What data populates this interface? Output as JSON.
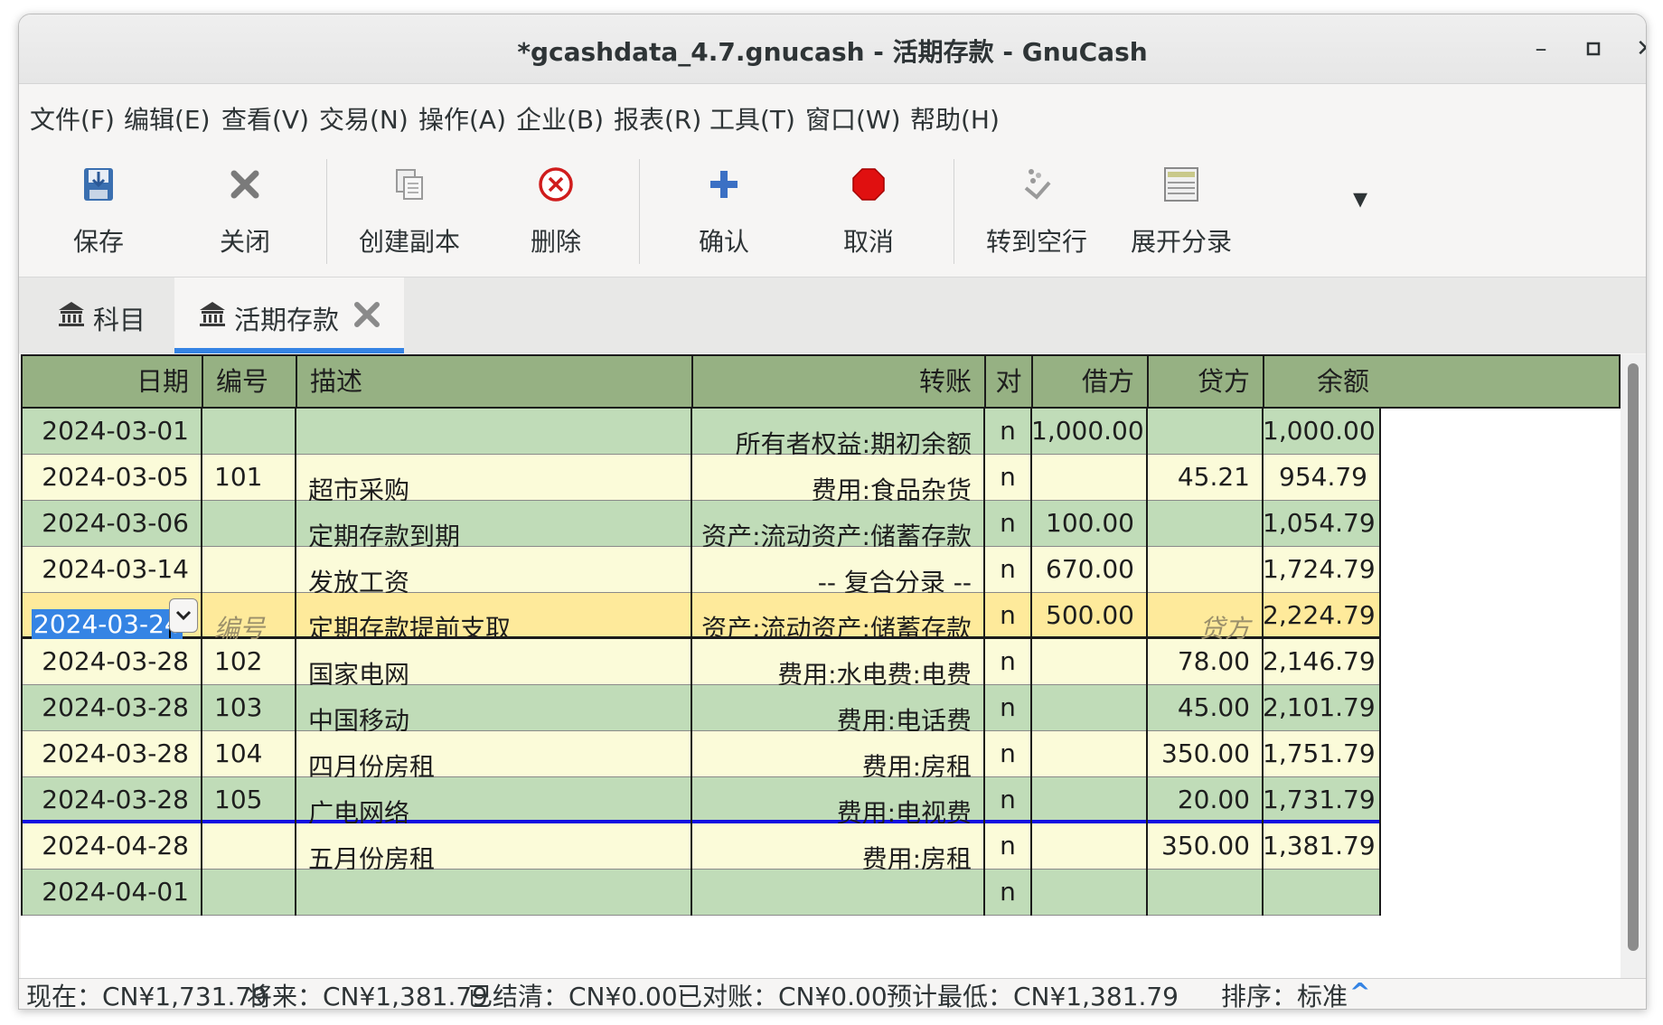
{
  "window": {
    "title": "*gcashdata_4.7.gnucash - 活期存款 - GnuCash",
    "minimize": "–",
    "maximize": "▫",
    "close": "✕"
  },
  "menu": [
    "文件(F)",
    "编辑(E)",
    "查看(V)",
    "交易(N)",
    "操作(A)",
    "企业(B)",
    "报表(R)",
    "工具(T)",
    "窗口(W)",
    "帮助(H)"
  ],
  "toolbar": {
    "save": "保存",
    "close": "关闭",
    "duplicate": "创建副本",
    "delete": "删除",
    "enter": "确认",
    "cancel": "取消",
    "blank": "转到空行",
    "split": "展开分录",
    "overflow": "▾"
  },
  "tabs": [
    {
      "label": "科目"
    },
    {
      "label": "活期存款"
    }
  ],
  "register": {
    "headers": {
      "date": "日期",
      "num": "编号",
      "desc": "描述",
      "transfer": "转账",
      "r": "对",
      "debit": "借方",
      "credit": "贷方",
      "balance": "余额"
    },
    "rows": [
      {
        "date": "2024-03-01",
        "num": "",
        "desc": "",
        "transfer": "所有者权益:期初余额",
        "r": "n",
        "debit": "1,000.00",
        "credit": "",
        "balance": "1,000.00"
      },
      {
        "date": "2024-03-05",
        "num": "101",
        "desc": "超市采购",
        "transfer": "费用:食品杂货",
        "r": "n",
        "debit": "",
        "credit": "45.21",
        "balance": "954.79"
      },
      {
        "date": "2024-03-06",
        "num": "",
        "desc": "定期存款到期",
        "transfer": "资产:流动资产:储蓄存款",
        "r": "n",
        "debit": "100.00",
        "credit": "",
        "balance": "1,054.79"
      },
      {
        "date": "2024-03-14",
        "num": "",
        "desc": "发放工资",
        "transfer": "-- 复合分录 --",
        "r": "n",
        "debit": "670.00",
        "credit": "",
        "balance": "1,724.79"
      },
      {
        "date": "2024-03-24",
        "num": "编号",
        "desc": "定期存款提前支取",
        "transfer": "资产:流动资产:储蓄存款",
        "r": "n",
        "debit": "500.00",
        "credit": "贷方",
        "balance": "2,224.79"
      },
      {
        "date": "2024-03-28",
        "num": "102",
        "desc": "国家电网",
        "transfer": "费用:水电费:电费",
        "r": "n",
        "debit": "",
        "credit": "78.00",
        "balance": "2,146.79"
      },
      {
        "date": "2024-03-28",
        "num": "103",
        "desc": "中国移动",
        "transfer": "费用:电话费",
        "r": "n",
        "debit": "",
        "credit": "45.00",
        "balance": "2,101.79"
      },
      {
        "date": "2024-03-28",
        "num": "104",
        "desc": "四月份房租",
        "transfer": "费用:房租",
        "r": "n",
        "debit": "",
        "credit": "350.00",
        "balance": "1,751.79"
      },
      {
        "date": "2024-03-28",
        "num": "105",
        "desc": "广电网络",
        "transfer": "费用:电视费",
        "r": "n",
        "debit": "",
        "credit": "20.00",
        "balance": "1,731.79"
      },
      {
        "date": "2024-04-28",
        "num": "",
        "desc": "五月份房租",
        "transfer": "费用:房租",
        "r": "n",
        "debit": "",
        "credit": "350.00",
        "balance": "1,381.79"
      },
      {
        "date": "2024-04-01",
        "num": "",
        "desc": "",
        "transfer": "",
        "r": "n",
        "debit": "",
        "credit": "",
        "balance": ""
      }
    ]
  },
  "status": {
    "present": "现在：CN¥1,731.79",
    "future": "将来：CN¥1,381.79",
    "cleared": "已结清：CN¥0.00",
    "reconciled": "已对账：CN¥0.00",
    "projected": "预计最低：CN¥1,381.79",
    "sort": "排序：标准",
    "sort_arrow": "^"
  },
  "colors": {
    "header": "#96b183",
    "row_green": "#c0dcb8",
    "row_yellow": "#fbfbd9",
    "row_selected": "#feea9b",
    "accent": "#3584e4",
    "future_line": "#1010e0"
  }
}
